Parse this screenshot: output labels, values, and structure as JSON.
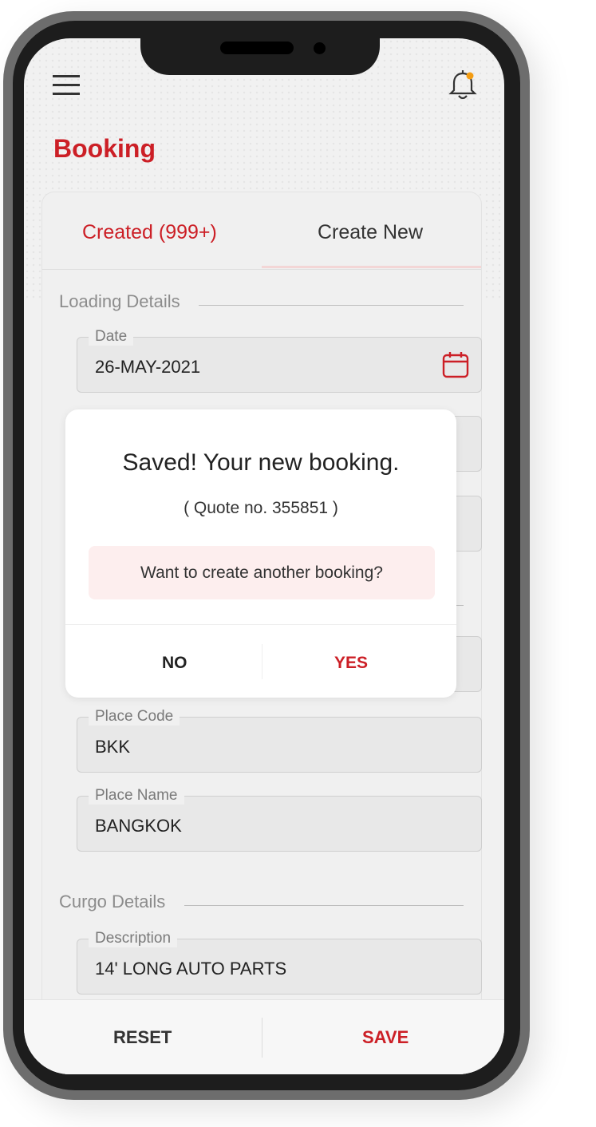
{
  "app": {
    "title": "Booking",
    "accent_color": "#cc1f26",
    "notification_dot_color": "#f39c12"
  },
  "header": {
    "menu_icon": "hamburger-menu-icon",
    "bell_icon": "bell-notification-icon"
  },
  "tabs": [
    {
      "label": "Created (999+)",
      "active": false
    },
    {
      "label": "Create New",
      "active": true
    }
  ],
  "sections": {
    "loading": "Loading Details",
    "cargo": "Curgo Details"
  },
  "fields": {
    "date": {
      "label": "Date",
      "value": "26-MAY-2021",
      "icon": "calendar-icon"
    },
    "place_code": {
      "label": "Place Code",
      "value": "BKK"
    },
    "place_name": {
      "label": "Place Name",
      "value": "BANGKOK"
    },
    "description": {
      "label": "Description",
      "value": "14' LONG AUTO PARTS"
    }
  },
  "dialog": {
    "title": "Saved! Your new booking.",
    "subtitle": "( Quote no. 355851 )",
    "prompt": "Want to create another booking?",
    "no_label": "NO",
    "yes_label": "YES"
  },
  "bottom_bar": {
    "reset_label": "RESET",
    "save_label": "SAVE"
  }
}
